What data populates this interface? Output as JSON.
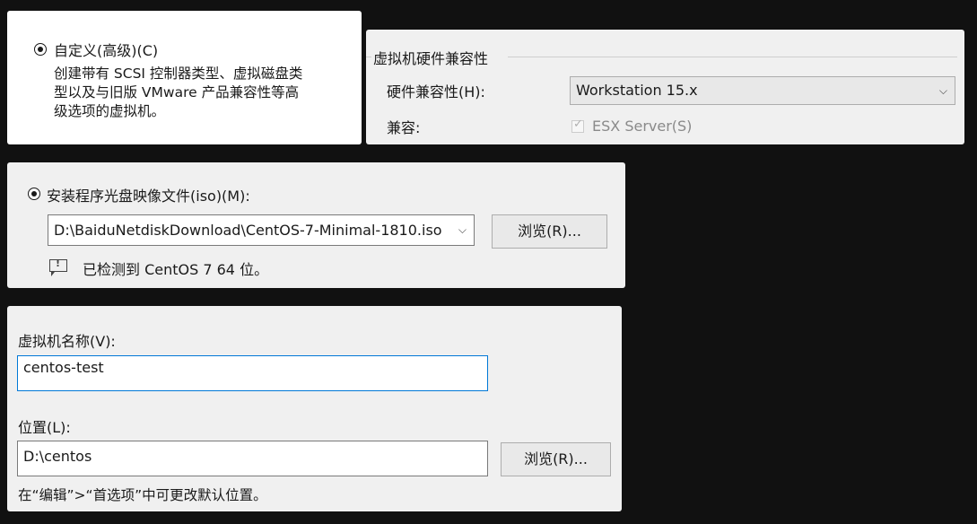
{
  "custom_option": {
    "label": "自定义(高级)(C)",
    "description_lines": [
      "创建带有 SCSI 控制器类型、虚拟磁盘类",
      "型以及与旧版 VMware 产品兼容性等高",
      "级选项的虚拟机。"
    ]
  },
  "hardware_compat": {
    "group_title": "虚拟机硬件兼容性",
    "compat_label": "硬件兼容性(H):",
    "compat_value": "Workstation 15.x",
    "compatible_label": "兼容:",
    "esx_label": "ESX Server(S)"
  },
  "iso": {
    "radio_label": "安装程序光盘映像文件(iso)(M):",
    "path": "D:\\BaiduNetdiskDownload\\CentOS-7-Minimal-1810.iso",
    "browse_label": "浏览(R)...",
    "detected": "已检测到 CentOS 7 64 位。"
  },
  "vm": {
    "name_label": "虚拟机名称(V):",
    "name_value": "centos-test",
    "location_label": "位置(L):",
    "location_value": "D:\\centos",
    "browse_label": "浏览(R)...",
    "hint": "在“编辑”>“首选项”中可更改默认位置。"
  },
  "icons": {
    "chevron": "chevron-down-icon",
    "info": "info-icon",
    "radio": "radio-selected-icon"
  }
}
